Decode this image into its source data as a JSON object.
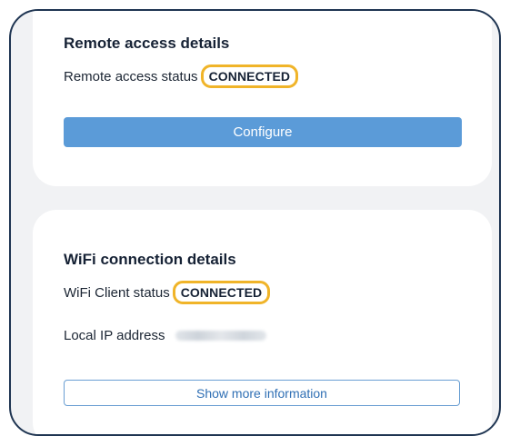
{
  "remote_access": {
    "title": "Remote access details",
    "status_label": "Remote access status",
    "status_value": "CONNECTED",
    "configure_label": "Configure"
  },
  "wifi": {
    "title": "WiFi connection details",
    "status_label": "WiFi Client status",
    "status_value": "CONNECTED",
    "ip_label": "Local IP address",
    "show_more_label": "Show more information"
  },
  "colors": {
    "primary_button": "#5b9bd8",
    "badge_highlight": "#f0b429",
    "frame": "#1f3552"
  }
}
